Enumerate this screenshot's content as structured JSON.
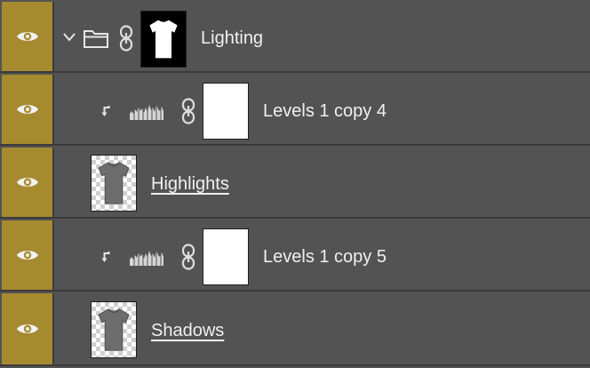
{
  "layers": [
    {
      "name": "Lighting",
      "kind": "group",
      "visible": true,
      "expanded": true,
      "icons": [
        "eye-icon",
        "chevron-down-icon",
        "folder-icon",
        "link-icon",
        "mask-thumbnail"
      ]
    },
    {
      "name": "Levels 1 copy 4",
      "kind": "levels-adjustment",
      "visible": true,
      "clipped": true,
      "icons": [
        "eye-icon",
        "clip-arrow-icon",
        "histogram-icon",
        "link-icon",
        "mask-thumbnail"
      ]
    },
    {
      "name": "Highlights",
      "kind": "pixel",
      "visible": true,
      "icons": [
        "eye-icon",
        "tshirt-thumbnail"
      ]
    },
    {
      "name": "Levels 1 copy 5",
      "kind": "levels-adjustment",
      "visible": true,
      "clipped": true,
      "icons": [
        "eye-icon",
        "clip-arrow-icon",
        "histogram-icon",
        "link-icon",
        "mask-thumbnail"
      ]
    },
    {
      "name": "Shadows",
      "kind": "pixel",
      "visible": true,
      "icons": [
        "eye-icon",
        "tshirt-thumbnail"
      ]
    }
  ],
  "colors": {
    "panel_bg": "#535353",
    "visibility_column": "#a68a30",
    "divider": "#3a3a3a",
    "text": "#f0f0f0"
  }
}
